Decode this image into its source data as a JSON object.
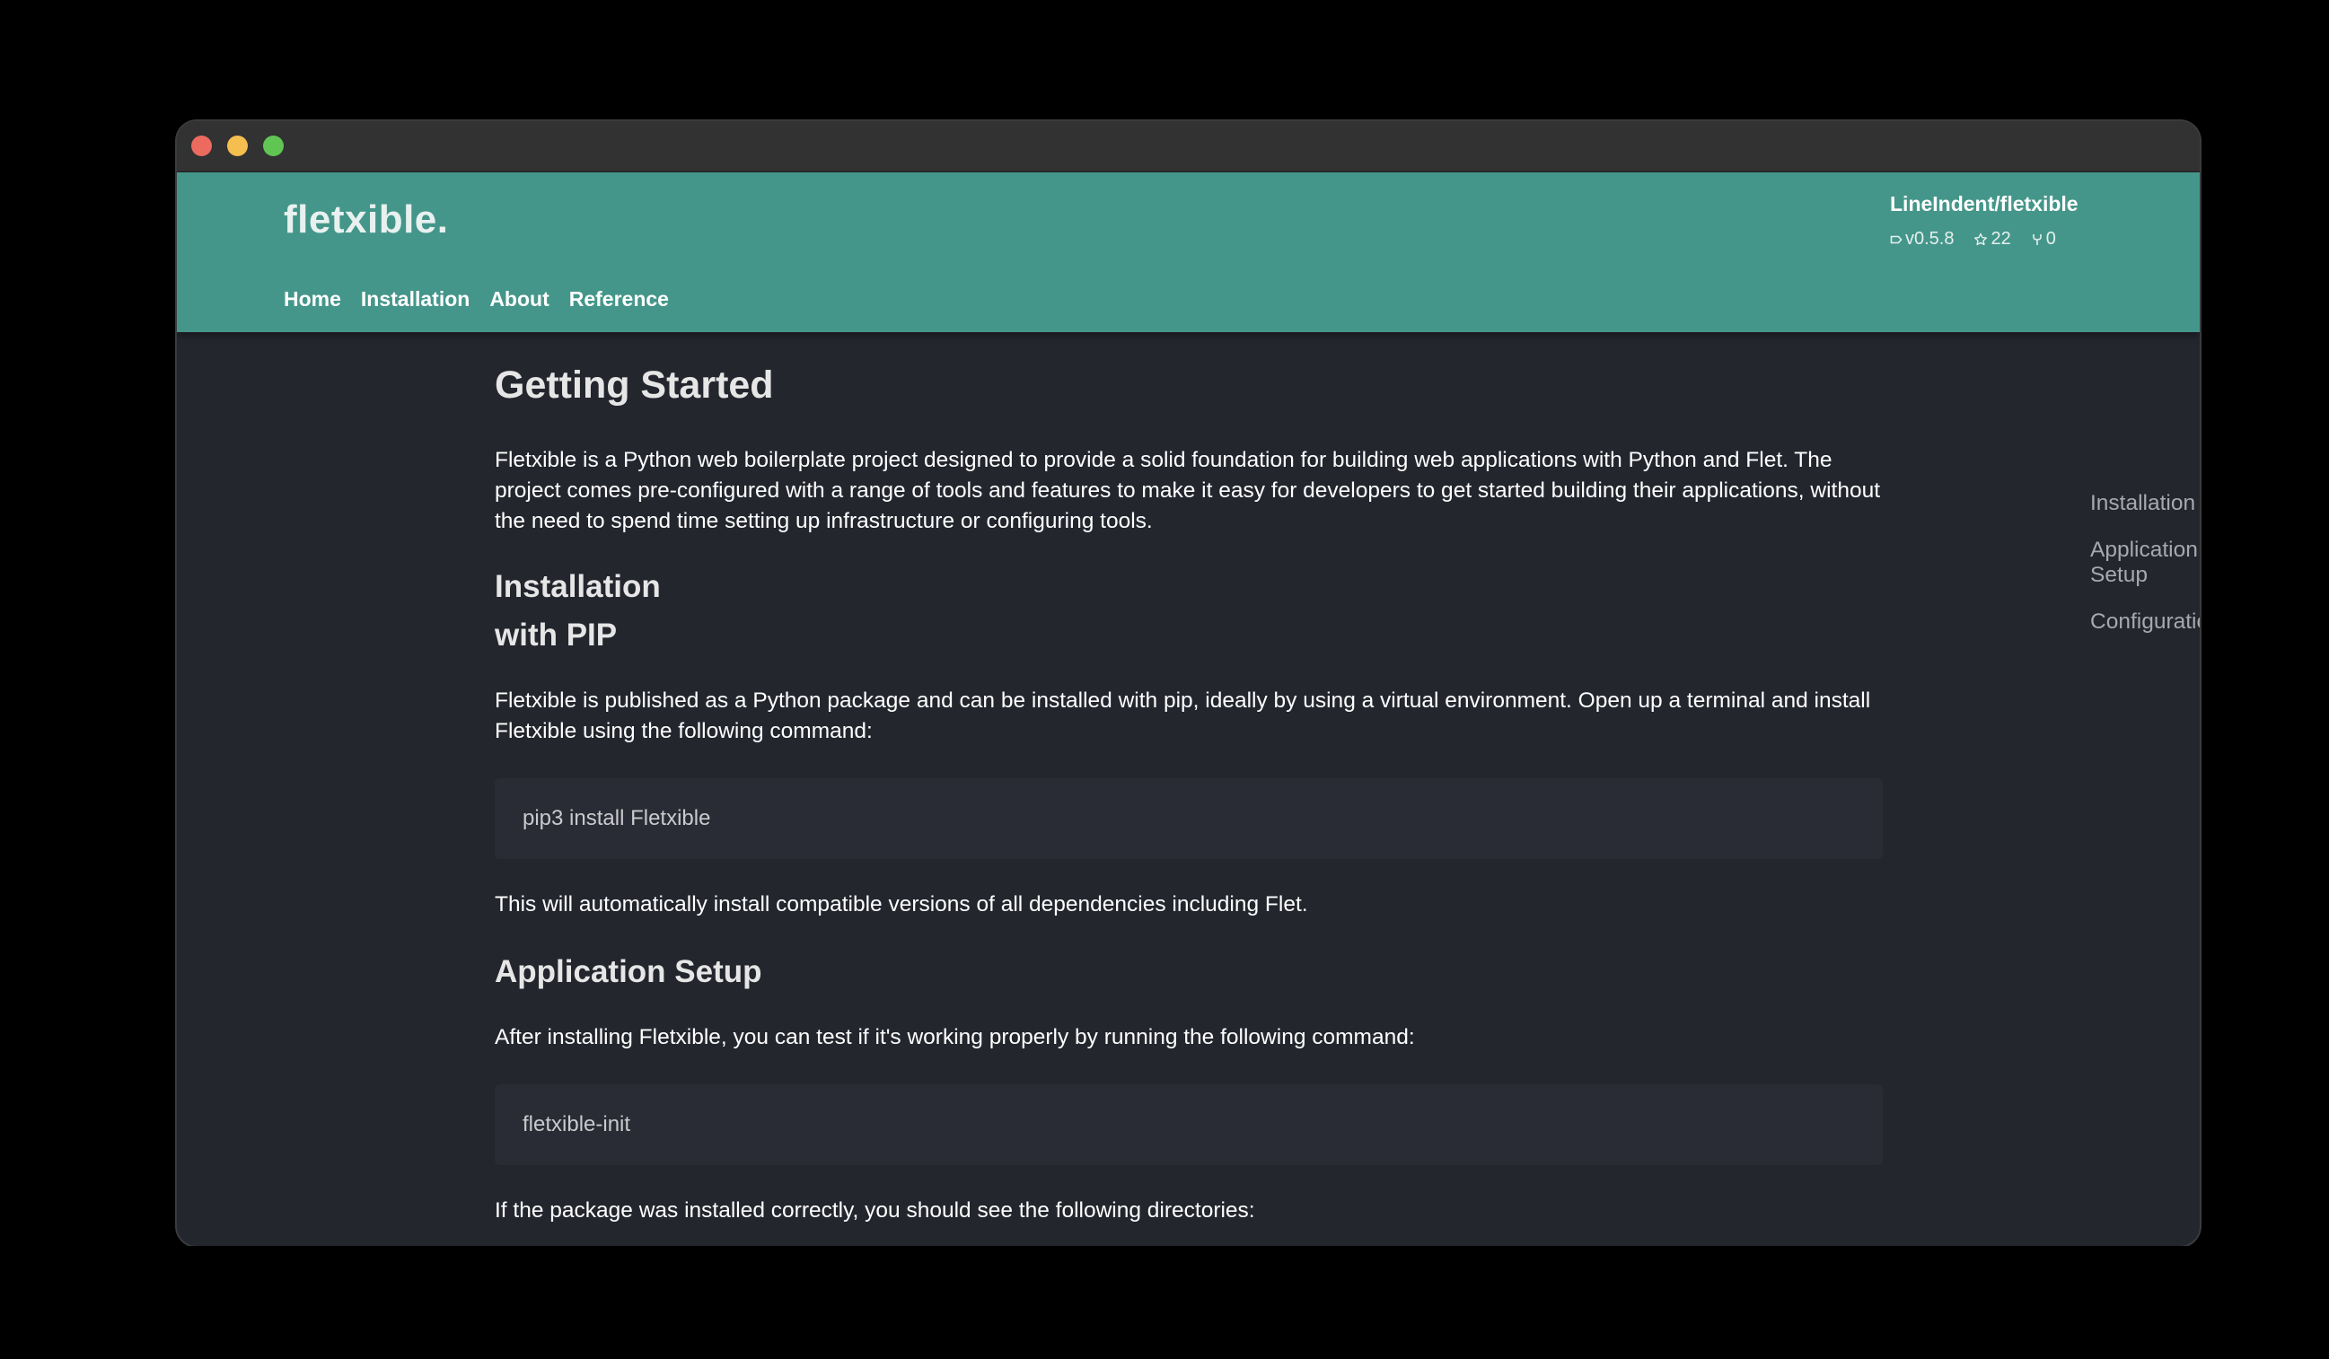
{
  "header": {
    "site_title": "fletxible.",
    "nav": [
      "Home",
      "Installation",
      "About",
      "Reference"
    ],
    "repo": {
      "name": "LineIndent/fletxible",
      "version": "v0.5.8",
      "stars": "22",
      "forks": "0"
    }
  },
  "toc": [
    "Installation",
    "Application Setup",
    "Configuration"
  ],
  "main": {
    "title": "Getting Started",
    "intro": "Fletxible is a Python web boilerplate project designed to provide a solid foundation for building web applications with Python and Flet. The project comes pre-configured with a range of tools and features to make it easy for developers to get started building their applications, without the need to spend time setting up infrastructure or configuring tools.",
    "installation_heading": "Installation",
    "pip_heading": "with PIP",
    "pip_text": "Fletxible is published as a Python package and can be installed with pip, ideally by using a virtual environment. Open up a terminal and install Fletxible using the following command:",
    "pip_command": "pip3 install Fletxible",
    "pip_note": "This will automatically install compatible versions of all dependencies including Flet.",
    "setup_heading": "Application Setup",
    "setup_text": "After installing Fletxible, you can test if it's working properly by running the following command:",
    "setup_command": "fletxible-init",
    "setup_note": "If the package was installed correctly, you should see the following directories:"
  },
  "colors": {
    "header_bg": "#44968a",
    "page_bg": "#24262e",
    "code_bg": "#2a2c35"
  }
}
